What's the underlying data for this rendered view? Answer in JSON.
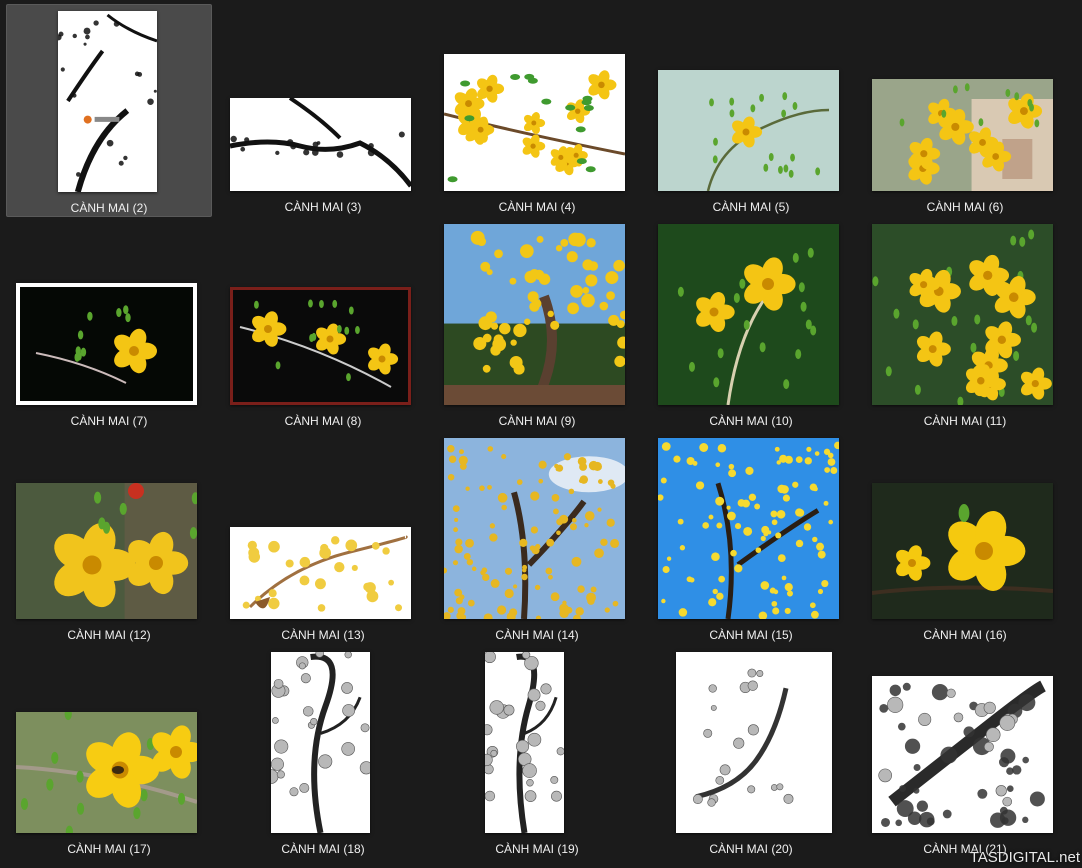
{
  "files": [
    {
      "label": "CÀNH MAI (2)",
      "kind": "ink-portrait-logo",
      "selected": true
    },
    {
      "label": "CÀNH MAI (3)",
      "kind": "ink-branch-white"
    },
    {
      "label": "CÀNH MAI (4)",
      "kind": "yellow-on-white"
    },
    {
      "label": "CÀNH MAI (5)",
      "kind": "buds-pale"
    },
    {
      "label": "CÀNH MAI (6)",
      "kind": "flowers-house"
    },
    {
      "label": "CÀNH MAI (7)",
      "kind": "flower-black-frame"
    },
    {
      "label": "CÀNH MAI (8)",
      "kind": "flowers-black-redframe"
    },
    {
      "label": "CÀNH MAI (9)",
      "kind": "bonsai-sky"
    },
    {
      "label": "CÀNH MAI (10)",
      "kind": "flowers-green"
    },
    {
      "label": "CÀNH MAI (11)",
      "kind": "flowers-dense"
    },
    {
      "label": "CÀNH MAI (12)",
      "kind": "closeup-flowers"
    },
    {
      "label": "CÀNH MAI (13)",
      "kind": "painted-branch-white"
    },
    {
      "label": "CÀNH MAI (14)",
      "kind": "tree-sky"
    },
    {
      "label": "CÀNH MAI (15)",
      "kind": "tree-blue-sky"
    },
    {
      "label": "CÀNH MAI (16)",
      "kind": "flower-dark"
    },
    {
      "label": "CÀNH MAI (17)",
      "kind": "flower-bee"
    },
    {
      "label": "CÀNH MAI (18)",
      "kind": "ink-blossom-tall"
    },
    {
      "label": "CÀNH MAI (19)",
      "kind": "ink-blossom-tall2"
    },
    {
      "label": "CÀNH MAI (20)",
      "kind": "ink-blossom-sparse"
    },
    {
      "label": "CÀNH MAI (21)",
      "kind": "ink-blossom-wide"
    }
  ],
  "watermark": "TASDIGITAL.net",
  "colors": {
    "background": "#1b1b1b",
    "selected": "#4a4a4a",
    "label": "#f0f0f0",
    "blossom": "#f4c514"
  }
}
